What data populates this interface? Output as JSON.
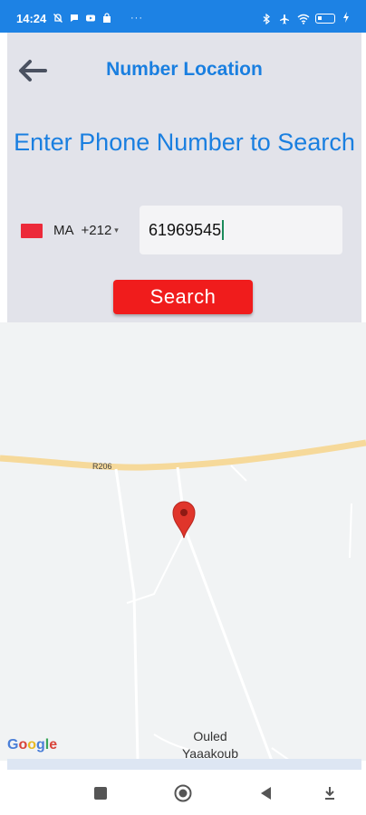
{
  "status_bar": {
    "time": "14:24",
    "left_icons": [
      "muted-bell-icon",
      "message-icon",
      "youtube-icon",
      "bag-icon"
    ],
    "more_indicator": "···",
    "right_icons": [
      "bluetooth-icon",
      "airplane-icon",
      "wifi-icon",
      "battery-icon",
      "charging-icon"
    ]
  },
  "header": {
    "title": "Number Location",
    "back_icon": "arrow-left-icon"
  },
  "form": {
    "heading": "Enter Phone Number to Search",
    "country_code": "MA",
    "dial_code": "+212",
    "phone_value": "61969545",
    "search_label": "Search"
  },
  "map": {
    "road_label": "R206",
    "place_label_line1": "Ouled",
    "place_label_line2": "Yaaakoub",
    "logo": {
      "g1": "G",
      "o1": "o",
      "o2": "o",
      "g2": "g",
      "l": "l",
      "e": "e"
    },
    "marker_icon": "map-pin-icon"
  },
  "navbar": {
    "buttons": [
      "recents-square-icon",
      "home-circle-icon",
      "back-triangle-icon",
      "download-arrow-icon"
    ]
  },
  "colors": {
    "status_bar": "#1d82e4",
    "accent_blue": "#1a7fe0",
    "search_button": "#f01c1c",
    "flag": "#ec2a3a",
    "panel_bg": "#e2e3ea",
    "map_bg": "#f1f3f4"
  }
}
